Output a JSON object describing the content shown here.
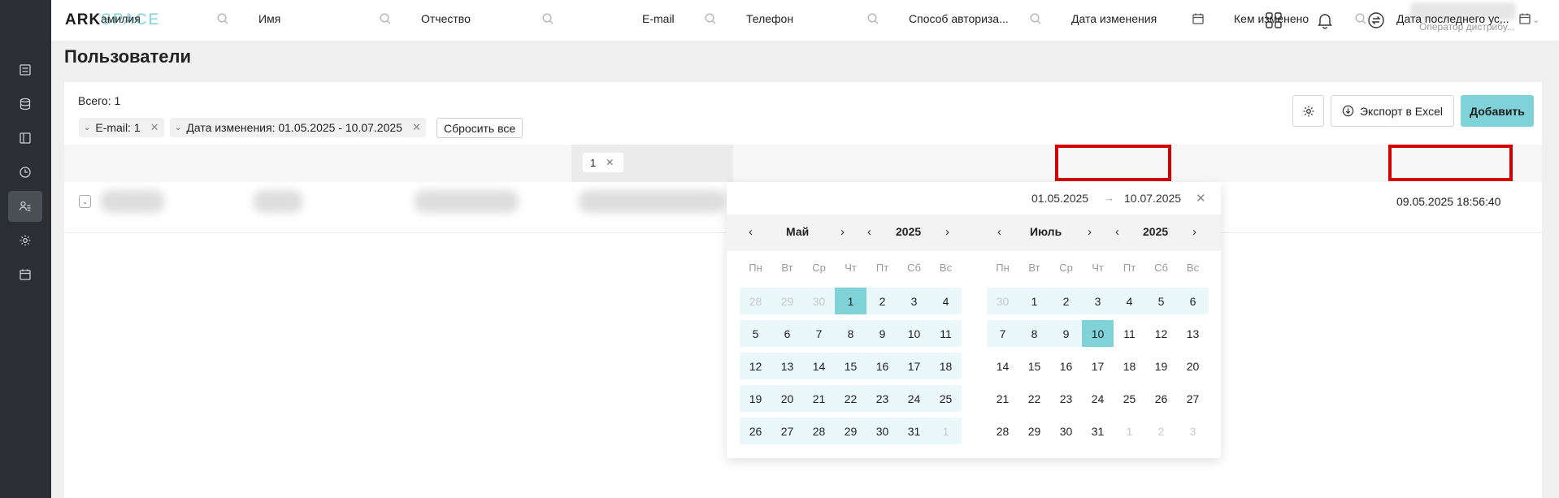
{
  "app": {
    "logo_part1": "ARK",
    "logo_part2": "SPACE"
  },
  "header": {
    "user_name_obscured": true,
    "user_role": "Оператор дистрибу..."
  },
  "page": {
    "title": "Пользователи"
  },
  "toolbar": {
    "total_label": "Всего: 1",
    "filters": [
      {
        "label": "E-mail: 1"
      },
      {
        "label": "Дата изменения: 01.05.2025 - 10.07.2025"
      }
    ],
    "reset_label": "Сбросить все",
    "export_label": "Экспорт в Excel",
    "add_label": "Добавить"
  },
  "table": {
    "columns": [
      {
        "label": "амилия"
      },
      {
        "label": "Имя"
      },
      {
        "label": "Отчество"
      },
      {
        "label": "E-mail",
        "filter_value": "1"
      },
      {
        "label": "Телефон"
      },
      {
        "label": "Способ авторизa..."
      },
      {
        "label": "Дата изменения"
      },
      {
        "label": "Кем изменено"
      },
      {
        "label": "Дата последнего ус..."
      }
    ],
    "rows": [
      {
        "last_login": "09.05.2025 18:56:40"
      }
    ]
  },
  "datepicker": {
    "from": "01.05.2025",
    "to": "10.07.2025",
    "weekdays": [
      "Пн",
      "Вт",
      "Ср",
      "Чт",
      "Пт",
      "Сб",
      "Вс"
    ],
    "left": {
      "month": "Май",
      "year": "2025",
      "days": [
        "28",
        "29",
        "30",
        "1",
        "2",
        "3",
        "4",
        "5",
        "6",
        "7",
        "8",
        "9",
        "10",
        "11",
        "12",
        "13",
        "14",
        "15",
        "16",
        "17",
        "18",
        "19",
        "20",
        "21",
        "22",
        "23",
        "24",
        "25",
        "26",
        "27",
        "28",
        "29",
        "30",
        "31",
        "1"
      ]
    },
    "right": {
      "month": "Июль",
      "year": "2025",
      "days": [
        "30",
        "1",
        "2",
        "3",
        "4",
        "5",
        "6",
        "7",
        "8",
        "9",
        "10",
        "11",
        "12",
        "13",
        "14",
        "15",
        "16",
        "17",
        "18",
        "19",
        "20",
        "21",
        "22",
        "23",
        "24",
        "25",
        "26",
        "27",
        "28",
        "29",
        "30",
        "31",
        "1",
        "2",
        "3"
      ]
    }
  },
  "icons": {
    "sidebar": [
      "list-icon",
      "database-icon",
      "book-icon",
      "clock-icon",
      "users-icon",
      "gear-icon",
      "calendar-icon"
    ],
    "header": [
      "apps-icon",
      "bell-icon",
      "swap-icon"
    ]
  },
  "colors": {
    "accent": "#7fd2d8",
    "range_bg": "#eaf8f9",
    "sidebar": "#2b2e33",
    "highlight": "#d40000"
  }
}
